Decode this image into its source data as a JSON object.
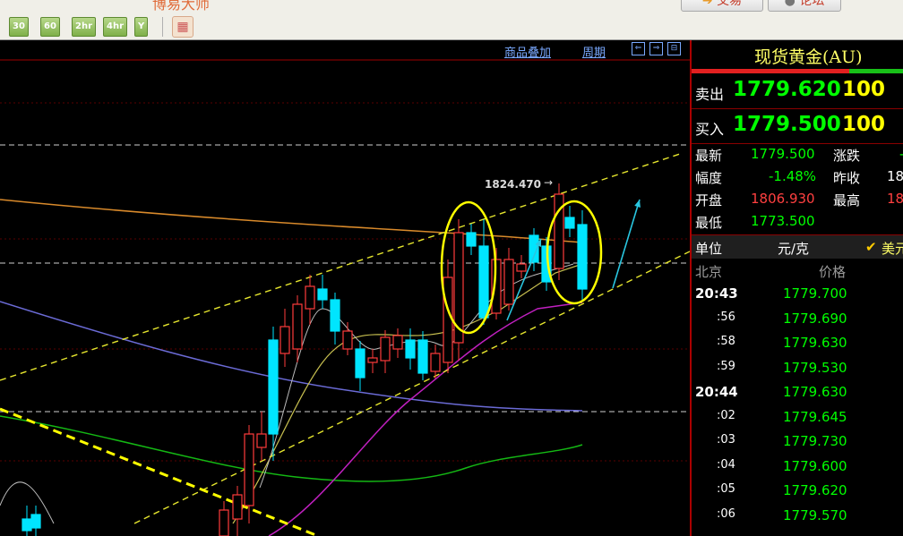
{
  "toolbar": {
    "app_name": "博易大师",
    "periods": [
      "30",
      "60",
      "2hr",
      "4hr",
      "Y"
    ],
    "trade_label": "交易",
    "forum_label": "论坛"
  },
  "chart": {
    "overlay_label": "商品叠加",
    "period_label": "周期",
    "high_label": "1824.470",
    "nav_icons": [
      "⇐",
      "⇒",
      "⊟"
    ]
  },
  "quote": {
    "name": "现货黄金(AU)",
    "sell_label": "卖出",
    "sell_price": "1779.620",
    "sell_vol": "100",
    "buy_label": "买入",
    "buy_price": "1779.500",
    "buy_vol": "100",
    "latest_label": "最新",
    "latest": "1779.500",
    "change_label": "涨跌",
    "change": "-",
    "amp_label": "幅度",
    "amp": "-1.48%",
    "prevclose_label": "昨收",
    "prevclose": "18",
    "open_label": "开盘",
    "open": "1806.930",
    "high_label": "最高",
    "high": "18",
    "low_label": "最低",
    "low": "1773.500",
    "unit_label": "单位",
    "unit": "元/克",
    "currency": "美元"
  },
  "ticks": {
    "col_time": "北京",
    "col_price": "价格",
    "rows": [
      {
        "time": "20:43",
        "price": "1779.700",
        "bold": true
      },
      {
        "time": ":56",
        "price": "1779.690",
        "bold": false
      },
      {
        "time": ":58",
        "price": "1779.630",
        "bold": false
      },
      {
        "time": ":59",
        "price": "1779.530",
        "bold": false
      },
      {
        "time": "20:44",
        "price": "1779.630",
        "bold": true
      },
      {
        "time": ":02",
        "price": "1779.645",
        "bold": false
      },
      {
        "time": ":03",
        "price": "1779.730",
        "bold": false
      },
      {
        "time": ":04",
        "price": "1779.600",
        "bold": false
      },
      {
        "time": ":05",
        "price": "1779.620",
        "bold": false
      },
      {
        "time": ":06",
        "price": "1779.570",
        "bold": false
      }
    ]
  },
  "colors": {
    "up": "#ff3b3b",
    "down": "#00e5ff",
    "price_green": "#00ff00",
    "price_red": "#ff4040",
    "label_gold": "#ffff66",
    "trend_yellow": "#e6e62e"
  }
}
